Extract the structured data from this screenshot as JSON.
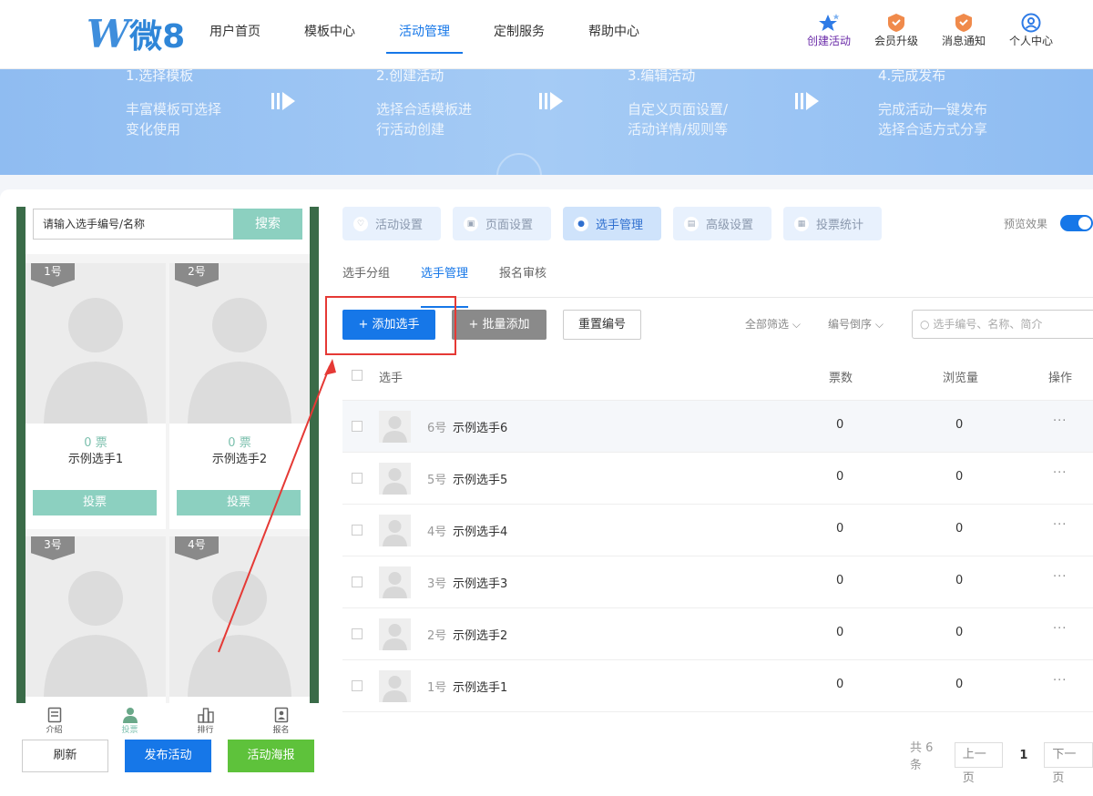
{
  "header": {
    "logo_w": "W",
    "logo_text": "微8",
    "nav": [
      {
        "label": "用户首页"
      },
      {
        "label": "模板中心"
      },
      {
        "label": "活动管理",
        "active": true
      },
      {
        "label": "定制服务"
      },
      {
        "label": "帮助中心"
      }
    ],
    "actions": [
      {
        "label": "创建活动",
        "icon": "star-icon"
      },
      {
        "label": "会员升级",
        "icon": "badge-icon"
      },
      {
        "label": "消息通知",
        "icon": "badge-icon"
      },
      {
        "label": "个人中心",
        "icon": "user-icon"
      }
    ]
  },
  "banner": {
    "steps": [
      {
        "title": "1.选择模板",
        "desc1": "丰富模板可选择",
        "desc2": "变化使用"
      },
      {
        "title": "2.创建活动",
        "desc1": "选择合适模板进",
        "desc2": "行活动创建"
      },
      {
        "title": "3.编辑活动",
        "desc1": "自定义页面设置/",
        "desc2": "活动详情/规则等"
      },
      {
        "title": "4.完成发布",
        "desc1": "完成活动一键发布",
        "desc2": "选择合适方式分享"
      }
    ]
  },
  "phone": {
    "search_placeholder": "请输入选手编号/名称",
    "search_button": "搜索",
    "cards": [
      {
        "tag": "1号",
        "votes": "0 票",
        "name": "示例选手1",
        "button": "投票"
      },
      {
        "tag": "2号",
        "votes": "0 票",
        "name": "示例选手2",
        "button": "投票"
      },
      {
        "tag": "3号"
      },
      {
        "tag": "4号"
      }
    ],
    "tabs": [
      {
        "label": "介绍"
      },
      {
        "label": "投票",
        "active": true
      },
      {
        "label": "排行"
      },
      {
        "label": "报名"
      }
    ]
  },
  "bottom_buttons": {
    "refresh": "刷新",
    "publish": "发布活动",
    "poster": "活动海报"
  },
  "main_tabs": [
    {
      "label": "活动设置"
    },
    {
      "label": "页面设置"
    },
    {
      "label": "选手管理",
      "active": true
    },
    {
      "label": "高级设置"
    },
    {
      "label": "投票统计"
    }
  ],
  "preview_label": "预览效果",
  "sub_tabs": [
    {
      "label": "选手分组"
    },
    {
      "label": "选手管理",
      "active": true
    },
    {
      "label": "报名审核"
    }
  ],
  "toolbar": {
    "add_label": "+ 添加选手",
    "batch_label": "+ 批量添加",
    "reset_label": "重置编号",
    "filter_label": "全部筛选",
    "sort_label": "编号倒序",
    "search_placeholder": "选手编号、名称、简介"
  },
  "table": {
    "headers": {
      "player": "选手",
      "votes": "票数",
      "views": "浏览量",
      "ops": "操作"
    },
    "rows": [
      {
        "num": "6号",
        "name": "示例选手6",
        "votes": "0",
        "views": "0",
        "ops": "···"
      },
      {
        "num": "5号",
        "name": "示例选手5",
        "votes": "0",
        "views": "0",
        "ops": "···"
      },
      {
        "num": "4号",
        "name": "示例选手4",
        "votes": "0",
        "views": "0",
        "ops": "···"
      },
      {
        "num": "3号",
        "name": "示例选手3",
        "votes": "0",
        "views": "0",
        "ops": "···"
      },
      {
        "num": "2号",
        "name": "示例选手2",
        "votes": "0",
        "views": "0",
        "ops": "···"
      },
      {
        "num": "1号",
        "name": "示例选手1",
        "votes": "0",
        "views": "0",
        "ops": "···"
      }
    ]
  },
  "pager": {
    "total": "共 6 条",
    "prev": "上一页",
    "current": "1",
    "next": "下一页"
  },
  "colors": {
    "primary": "#1677e8",
    "teal": "#8cd0c0",
    "green": "#5ec23b",
    "annotation_red": "#e53935"
  }
}
